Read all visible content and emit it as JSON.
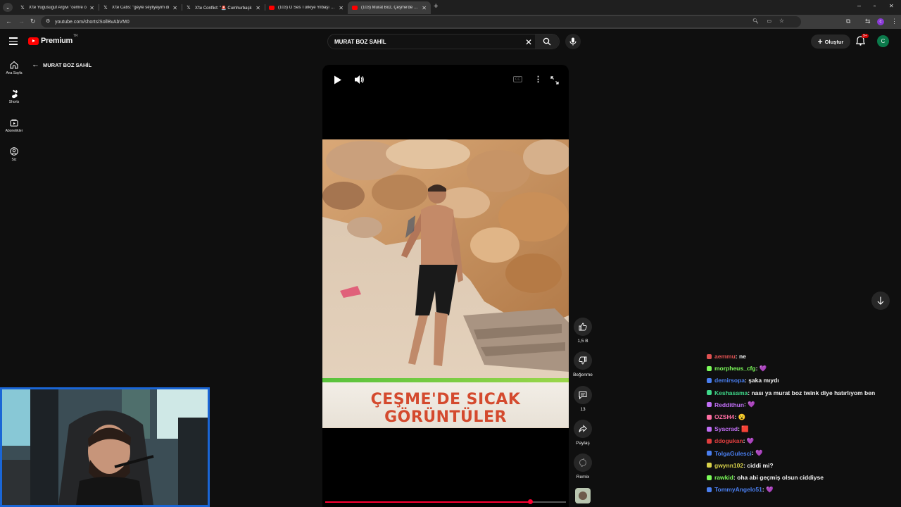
{
  "browser": {
    "tabs": [
      {
        "icon": "x-logo-icon",
        "title": "X'te Yugusuguf Argivi \"cemre o"
      },
      {
        "icon": "x-logo-icon",
        "title": "X'te Cabs: \"gèyle sêyliyeyim di"
      },
      {
        "icon": "x-logo-icon",
        "title": "X'te Conflict: \"🚨 Cumhurbaşk"
      },
      {
        "icon": "youtube-icon",
        "title": "(103) O Ses Türkiye Yilbaşı Özel"
      },
      {
        "icon": "youtube-icon",
        "title": "(103) Murat Boz, Çeşme'de kar"
      }
    ],
    "url": "youtube.com/shorts/SollBvAbVM0"
  },
  "youtube": {
    "logo_text": "Premium",
    "logo_sup": "TR",
    "search_query": "MURAT BOZ SAHİL",
    "create_label": "Oluştur",
    "notif_count": "9+",
    "avatar_letter": "C",
    "back_label": "MURAT BOZ SAHİL",
    "guide": [
      {
        "icon": "home-icon",
        "label": "Ana Sayfa"
      },
      {
        "icon": "shorts-icon",
        "label": "Shorts"
      },
      {
        "icon": "subscriptions-icon",
        "label": "Abonelikler"
      },
      {
        "icon": "you-icon",
        "label": "Siz"
      }
    ]
  },
  "short": {
    "caption": "ÇEŞME'DE SICAK GÖRÜNTÜLER",
    "progress": 0.85,
    "actions": {
      "like_count": "1,5 B",
      "dislike_label": "Beğenme",
      "comments_count": "13",
      "share_label": "Paylaş",
      "remix_label": "Remix"
    }
  },
  "chat": [
    {
      "user": "aemmu",
      "msg": ": ne",
      "color": "#e05252"
    },
    {
      "user": "morpheus_cfg",
      "msg": ": 💜",
      "color": "#7cfc5a"
    },
    {
      "user": "demirsopa",
      "msg": ": şaka mıydı",
      "color": "#4a7ff0"
    },
    {
      "user": "Keshasama",
      "msg": ": nası ya murat boz twink diye hatırlıyom ben",
      "color": "#3fd98a"
    },
    {
      "user": "Reddithun",
      "msg": ": 💜",
      "color": "#c06ef5"
    },
    {
      "user": "OZSH4",
      "msg": ": 😮",
      "color": "#ff6fa4"
    },
    {
      "user": "Syacrad",
      "msg": ": 🟥",
      "color": "#c06ef5"
    },
    {
      "user": "ddogukan",
      "msg": ": 💜",
      "color": "#e03e3e"
    },
    {
      "user": "TolgaGulesci",
      "msg": ": 💜",
      "color": "#4a7ff0"
    },
    {
      "user": "gwynn102",
      "msg": ": ciddi mi?",
      "color": "#d9d24a"
    },
    {
      "user": "rawkid",
      "msg": ": oha abi geçmiş olsun ciddiyse",
      "color": "#7cfc5a"
    },
    {
      "user": "TommyAngelo51",
      "msg": ": 💜",
      "color": "#4a7ff0"
    }
  ],
  "colors": {
    "brand_red": "#ff0000",
    "progress_red": "#ff0033",
    "caption_red": "#d44a2e",
    "webcam_border": "#1a66d6"
  }
}
